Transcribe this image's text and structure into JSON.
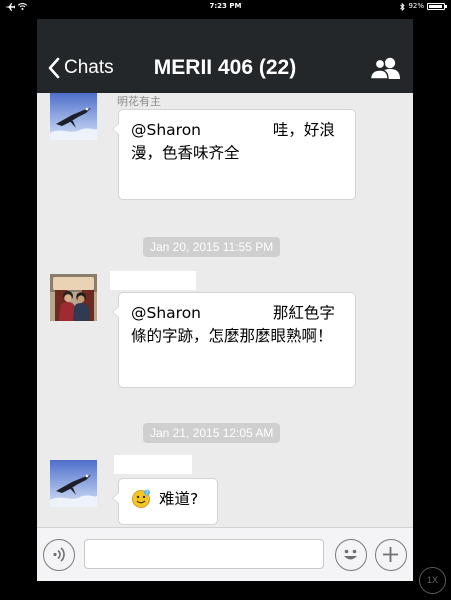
{
  "status_bar": {
    "time": "7:23 PM",
    "battery_text": "92%",
    "battery_level": 0.92
  },
  "nav": {
    "back_label": "Chats",
    "title": "MERII 406 (22)"
  },
  "messages": [
    {
      "type": "message",
      "sender": "明花有主",
      "text_prefix": "@Sharon",
      "text_suffix": "哇，好浪漫，色香味齐全",
      "mention_redacted": true
    },
    {
      "type": "timestamp",
      "text": "Jan 20, 2015 11:55 PM"
    },
    {
      "type": "message",
      "sender": "",
      "text_prefix": "@Sharon",
      "text_suffix": "那紅色字條的字跡，怎麼那麼眼熟啊！",
      "mention_redacted": true
    },
    {
      "type": "timestamp",
      "text": "Jan 21, 2015 12:05 AM"
    },
    {
      "type": "message",
      "sender": "",
      "sticker": "smiling-face-sticker",
      "text": "难道?"
    }
  ],
  "input": {
    "value": "",
    "placeholder": ""
  },
  "zoom_label": "1X",
  "icons": {
    "back": "chevron-left-icon",
    "members": "group-members-icon",
    "voice": "voice-input-icon",
    "emoji": "emoji-icon",
    "more": "plus-icon"
  },
  "colors": {
    "nav_bg": "#23272a",
    "chat_bg": "#ebebeb",
    "timestamp_bg": "#cfcfcf"
  }
}
